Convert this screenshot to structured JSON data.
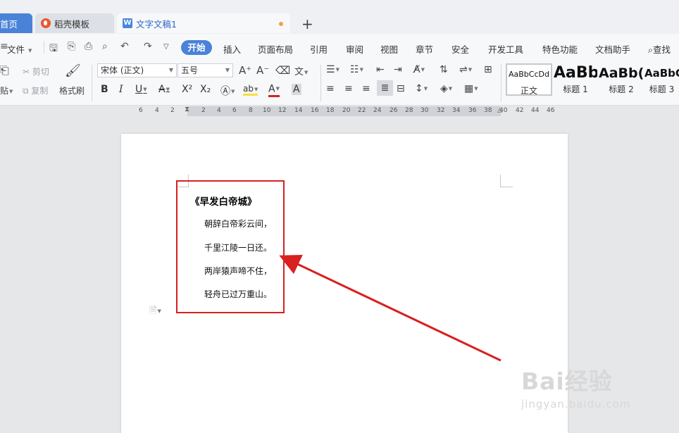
{
  "tabs": {
    "home": "首页",
    "template": "稻壳模板",
    "document": "文字文稿1",
    "add": "+"
  },
  "menu": {
    "file": "文件",
    "items": [
      "开始",
      "插入",
      "页面布局",
      "引用",
      "审阅",
      "视图",
      "章节",
      "安全",
      "开发工具",
      "特色功能",
      "文档助手"
    ],
    "search": "查找"
  },
  "ribbon": {
    "cut": "剪切",
    "copy": "复制",
    "paste": "贴",
    "format_painter": "格式刷",
    "font_name": "宋体 (正文)",
    "font_size": "五号",
    "bold": "B",
    "italic": "I",
    "underline": "U",
    "superscript": "X²",
    "subscript": "X₂",
    "styles": [
      {
        "sample": "AaBbCcDd",
        "label": "正文"
      },
      {
        "sample": "AaBb",
        "label": "标题 1"
      },
      {
        "sample": "AaBb(",
        "label": "标题 2"
      },
      {
        "sample": "AaBbC",
        "label": "标题 3"
      }
    ]
  },
  "ruler": {
    "numbers": [
      "6",
      "4",
      "2",
      "2",
      "2",
      "4",
      "6",
      "8",
      "10",
      "12",
      "14",
      "16",
      "18",
      "20",
      "22",
      "24",
      "26",
      "28",
      "30",
      "32",
      "34",
      "36",
      "38",
      "40",
      "42",
      "44",
      "46"
    ]
  },
  "document": {
    "title": "《早发白帝城》",
    "lines": [
      "朝辞白帝彩云间，",
      "千里江陵一日还。",
      "两岸猿声啼不住，",
      "轻舟已过万重山。"
    ]
  },
  "annotation": {
    "color": "#d82020"
  },
  "watermark": {
    "brand": "Bai经验",
    "url": "jingyan.baidu.com"
  }
}
